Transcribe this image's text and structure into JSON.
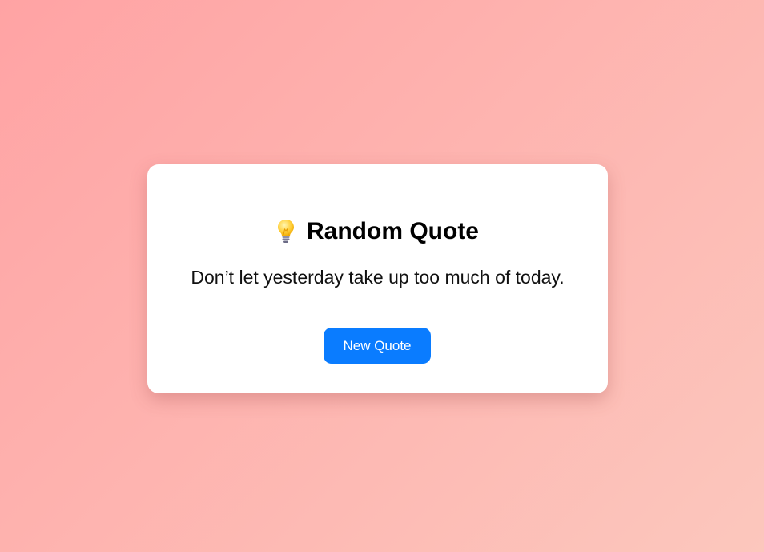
{
  "card": {
    "title": "Random Quote",
    "icon": "lightbulb-icon",
    "quote": "Don’t let yesterday take up too much of today.",
    "button_label": "New Quote"
  },
  "colors": {
    "background_start": "#ffa3a4",
    "background_end": "#fcc7bd",
    "card": "#ffffff",
    "button": "#0a7cff",
    "button_text": "#ffffff"
  }
}
